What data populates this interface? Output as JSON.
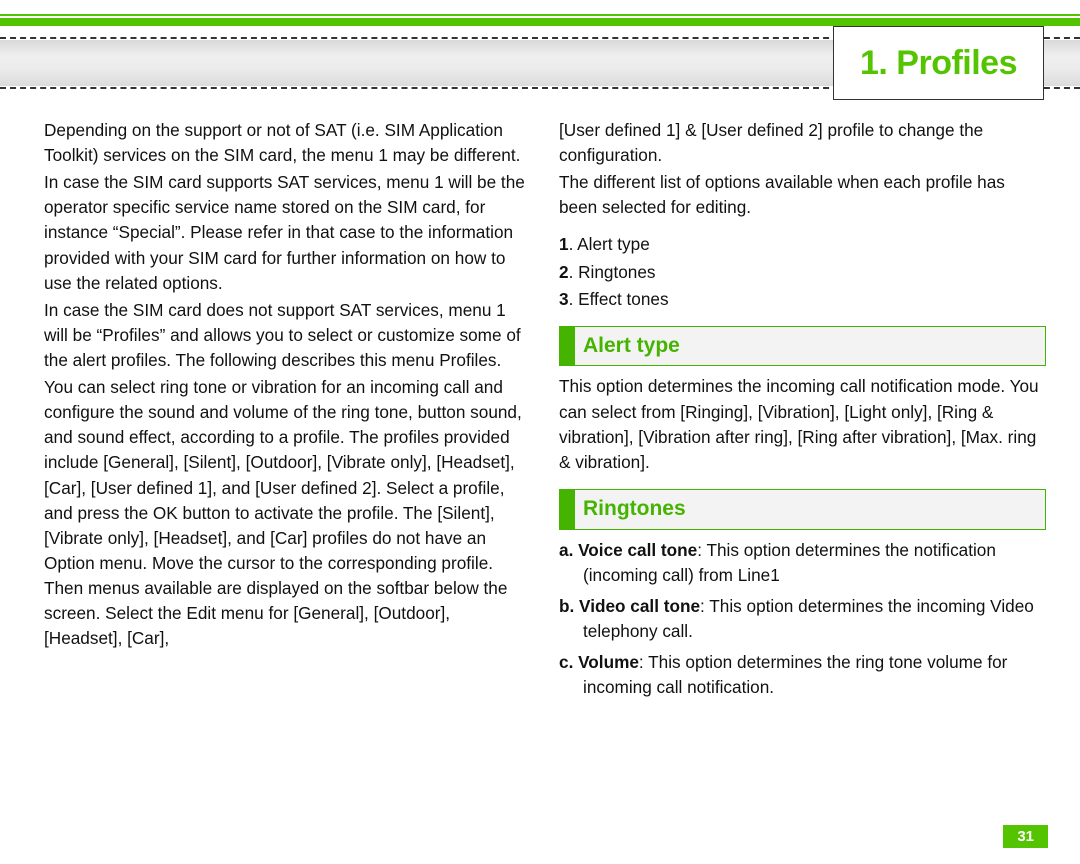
{
  "chapter": "1. Profiles",
  "page_number": "31",
  "left": {
    "p1": "Depending on the support or not of SAT (i.e. SIM Application Toolkit) services on the SIM card, the menu 1 may be different.",
    "p2": "In case the SIM card supports SAT services, menu 1 will be the operator specific service name stored on the SIM card, for instance “Special”. Please refer in that case to the information provided with your SIM card for further information on how to use the related options.",
    "p3": "In case the SIM card does not support SAT services, menu 1 will be “Profiles” and allows you to select or customize some of the alert profiles. The following describes this menu Profiles.",
    "p4": "You can select ring tone or vibration for an incoming call and configure the sound and volume of the ring tone, button sound, and sound effect, according to a profile. The profiles provided include [General], [Silent], [Outdoor], [Vibrate only], [Headset], [Car], [User defined 1], and [User defined 2]. Select a profile, and press the OK button to activate the profile. The [Silent], [Vibrate only], [Headset], and [Car] profiles do not have an Option menu. Move the cursor to the corresponding profile. Then menus available are displayed on the softbar below the screen. Select the Edit menu for [General], [Outdoor], [Headset], [Car],"
  },
  "right": {
    "intro1": "[User defined 1] & [User defined 2] profile to change the configuration.",
    "intro2": "The different list of options available when each profile has been selected for editing.",
    "options": {
      "a": ". Alert type",
      "b": ". Ringtones",
      "c": ". Effect tones",
      "n1": "1",
      "n2": "2",
      "n3": "3"
    },
    "alert_type_header": "Alert type",
    "alert_type_body": "This option determines the incoming call notification mode. You can select from [Ringing], [Vibration], [Light only], [Ring & vibration], [Vibration after ring], [Ring after vibration], [Max. ring & vibration].",
    "ringtones_header": "Ringtones",
    "ringtones": {
      "a_label": "a",
      "a_bold": ". Voice call tone",
      "a_rest": ": This option determines the notification (incoming call) from Line1",
      "b_label": "b",
      "b_bold": ". Video call tone",
      "b_rest": ": This option determines the incoming Video telephony call.",
      "c_label": "c",
      "c_bold": ". Volume",
      "c_rest": ": This option determines the ring tone volume for incoming call notification."
    }
  }
}
